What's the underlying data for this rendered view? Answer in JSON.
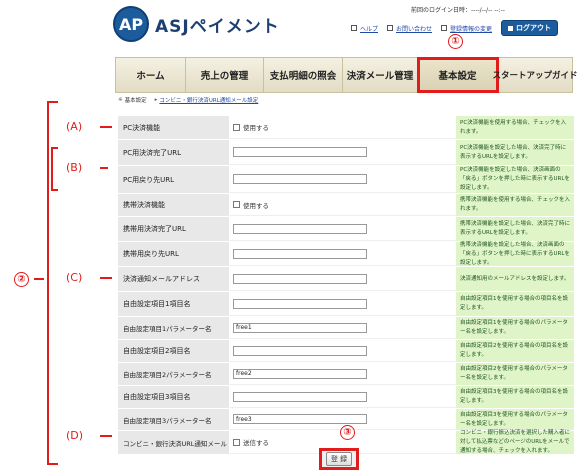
{
  "header": {
    "logo_mark": "AP",
    "logo_text": "ASJペイメント",
    "last_login": "前回のログイン日時：----/--/-- --:--",
    "links": [
      {
        "label": "ヘルプ"
      },
      {
        "label": "お問い合わせ"
      },
      {
        "label": "登録情報の変更"
      }
    ],
    "logout_label": "ログアウト"
  },
  "nav": {
    "tabs": [
      {
        "label": "ホーム"
      },
      {
        "label": "売上の管理"
      },
      {
        "label": "支払明細の照会"
      },
      {
        "label": "決済メール管理"
      },
      {
        "label": "基本設定"
      },
      {
        "label": "スタートアップガイド"
      }
    ]
  },
  "breadcrumb": {
    "current": "基本設定",
    "link": "コンビニ・銀行決済URL通知メール設定"
  },
  "form": {
    "rows": [
      {
        "label": "PC決済機能",
        "type": "checkbox",
        "check_label": "使用する",
        "value": "",
        "note": "PC決済機能を使用する場合、チェックを入れます。"
      },
      {
        "label": "PC用決済完了URL",
        "type": "text",
        "value": "",
        "note": "PC決済機能を設定した場合、決済完了時に表示するURLを設定します。"
      },
      {
        "label": "PC用戻り先URL",
        "type": "text",
        "value": "",
        "note": "PC決済機能を設定した場合、決済画面の「戻る」ボタンを押した時に表示するURLを設定します。"
      },
      {
        "label": "携帯決済機能",
        "type": "checkbox",
        "check_label": "使用する",
        "value": "",
        "note": "携帯決済機能を使用する場合、チェックを入れます。"
      },
      {
        "label": "携帯用決済完了URL",
        "type": "text",
        "value": "",
        "note": "携帯決済機能を設定した場合、決済完了時に表示するURLを設定します。"
      },
      {
        "label": "携帯用戻り先URL",
        "type": "text",
        "value": "",
        "note": "携帯決済機能を設定した場合、決済画面の「戻る」ボタンを押した時に表示するURLを設定します。"
      },
      {
        "label": "決済通知メールアドレス",
        "type": "text",
        "value": "",
        "note": "決済通知用のメールアドレスを設定します。"
      },
      {
        "label": "自由設定項目1項目名",
        "type": "text",
        "value": "",
        "note": "自由設定項目1を使用する場合の項目名を設定します。"
      },
      {
        "label": "自由設定項目1パラメーター名",
        "type": "text",
        "value": "free1",
        "note": "自由設定項目1を使用する場合のパラメーター名を設定します。"
      },
      {
        "label": "自由設定項目2項目名",
        "type": "text",
        "value": "",
        "note": "自由設定項目2を使用する場合の項目名を設定します。"
      },
      {
        "label": "自由設定項目2パラメーター名",
        "type": "text",
        "value": "free2",
        "note": "自由設定項目2を使用する場合のパラメーター名を設定します。"
      },
      {
        "label": "自由設定項目3項目名",
        "type": "text",
        "value": "",
        "note": "自由設定項目3を使用する場合の項目名を設定します。"
      },
      {
        "label": "自由設定項目3パラメーター名",
        "type": "text",
        "value": "free3",
        "note": "自由設定項目3を使用する場合のパラメーター名を設定します。"
      },
      {
        "label": "コンビニ・銀行決済URL通知メール",
        "type": "checkbox",
        "check_label": "送信する",
        "value": "",
        "note": "コンビニ・銀行振込決済を選択した購入者に対して払込票などのページのURLをメールで通知する場合、チェックを入れます。"
      }
    ],
    "submit_label": "登 録"
  },
  "annotations": {
    "a": "(A)",
    "b": "(B)",
    "c": "(C)",
    "d": "(D)",
    "one": "①",
    "two": "②",
    "three": "③"
  },
  "colors": {
    "brand": "#1d5c9c",
    "annotation": "#e21b1b",
    "note_bg": "#dff5c8"
  }
}
